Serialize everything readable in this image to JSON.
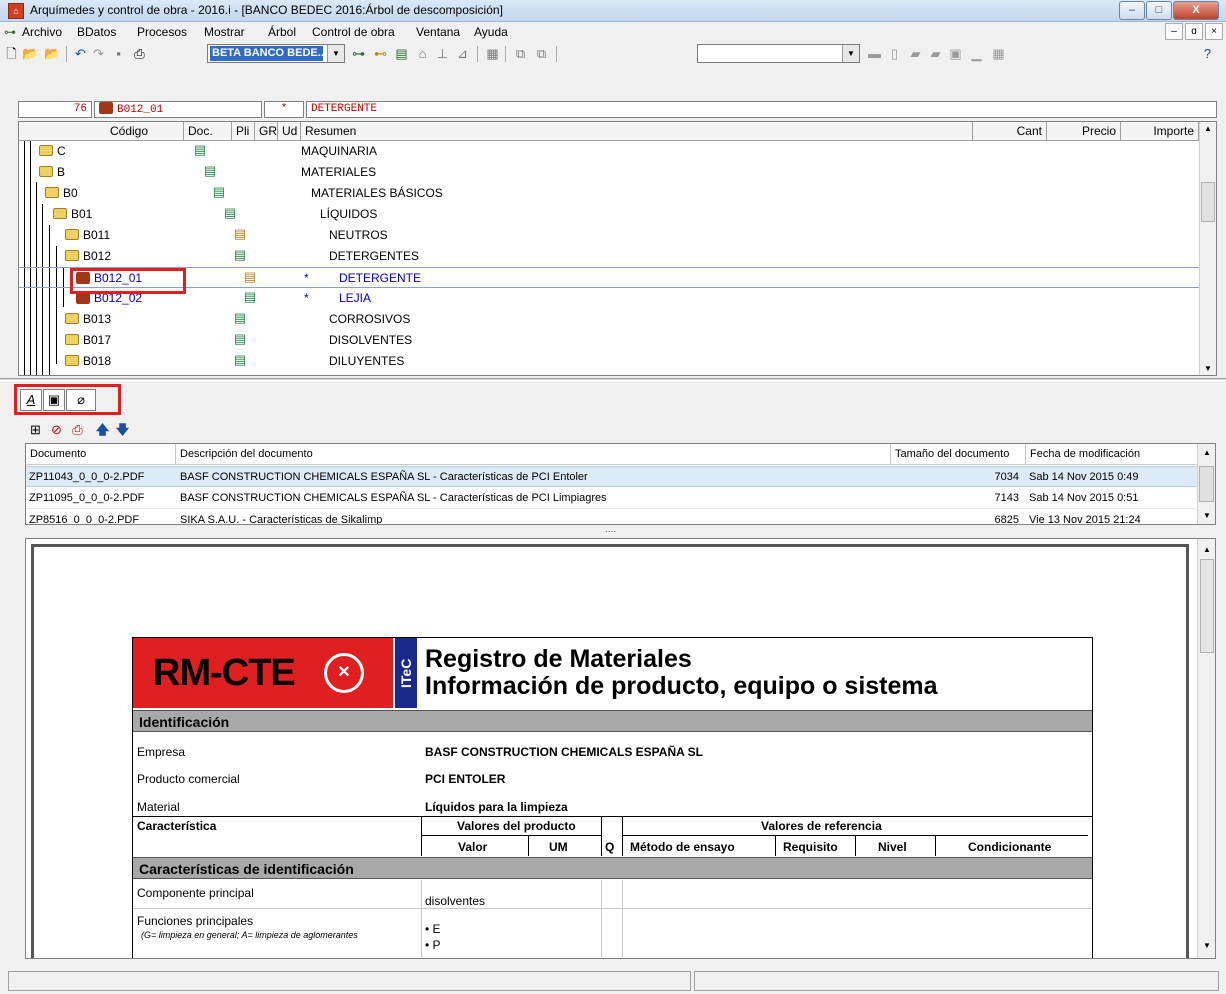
{
  "window": {
    "title": "Arquímedes y control de obra - 2016.i - [BANCO BEDEC 2016:Árbol de descomposición]",
    "min_label": "–",
    "max_label": "□",
    "close_label": "X"
  },
  "menu": {
    "items": [
      "Archivo",
      "BDatos",
      "Procesos",
      "Mostrar",
      "Árbol",
      "Control de obra",
      "Ventana",
      "Ayuda"
    ],
    "mdi_min": "–",
    "mdi_restore": "ɑ",
    "mdi_close": "×"
  },
  "toolbar": {
    "bank_combo": "BETA BANCO BEDE...",
    "search_combo": ""
  },
  "infobar": {
    "count": "76",
    "code": "B012_01",
    "star": "*",
    "summary": "DETERGENTE"
  },
  "tree": {
    "headers": {
      "codigo": "Código",
      "doc": "Doc.",
      "pli": "Pli",
      "gr": "GR",
      "ud": "Ud",
      "resumen": "Resumen",
      "cant": "Cant",
      "precio": "Precio",
      "importe": "Importe"
    },
    "rows": [
      {
        "code": "C",
        "type": "folder",
        "star": "",
        "summary": "MAQUINARIA",
        "selected": false
      },
      {
        "code": "B",
        "type": "folder",
        "star": "",
        "summary": "MATERIALES",
        "selected": false
      },
      {
        "code": "B0",
        "type": "folder",
        "star": "",
        "summary": "MATERIALES BÁSICOS",
        "selected": false
      },
      {
        "code": "B01",
        "type": "folder",
        "star": "",
        "summary": "LÍQUIDOS",
        "selected": false
      },
      {
        "code": "B011",
        "type": "folder",
        "star": "",
        "summary": "NEUTROS",
        "selected": false
      },
      {
        "code": "B012",
        "type": "folder",
        "star": "",
        "summary": "DETERGENTES",
        "selected": false
      },
      {
        "code": "B012_01",
        "type": "material",
        "star": "*",
        "summary": "DETERGENTE",
        "selected": true
      },
      {
        "code": "B012_02",
        "type": "material",
        "star": "*",
        "summary": "LEJIA",
        "selected": false
      },
      {
        "code": "B013",
        "type": "folder",
        "star": "",
        "summary": "CORROSIVOS",
        "selected": false
      },
      {
        "code": "B017",
        "type": "folder",
        "star": "",
        "summary": "DISOLVENTES",
        "selected": false
      },
      {
        "code": "B018",
        "type": "folder",
        "star": "",
        "summary": "DILUYENTES",
        "selected": false
      }
    ]
  },
  "tabs": {
    "text": "A",
    "image": "▣",
    "attach": "⌀"
  },
  "doclist": {
    "headers": {
      "documento": "Documento",
      "descripcion": "Descripción del documento",
      "tamano": "Tamaño del documento",
      "fecha": "Fecha de modificación"
    },
    "rows": [
      {
        "file": "ZP11043_0_0_0-2.PDF",
        "desc": "BASF CONSTRUCTION CHEMICALS ESPAÑA SL - Características de PCI Entoler",
        "size": "7034",
        "date": "Sab 14 Nov 2015  0:49"
      },
      {
        "file": "ZP11095_0_0_0-2.PDF",
        "desc": "BASF CONSTRUCTION CHEMICALS ESPAÑA SL - Características de PCI Limpiagres",
        "size": "7143",
        "date": "Sab 14 Nov 2015  0:51"
      },
      {
        "file": "ZP8516_0_0_0-2.PDF",
        "desc": "SIKA S.A.U. - Características de Sikalimp",
        "size": "6825",
        "date": "Vie 13 Nov 2015  21:24"
      }
    ],
    "splitter_dots": "...."
  },
  "pdf": {
    "logo": "RM-CTE",
    "itec": "ITeC",
    "title1": "Registro de Materiales",
    "title2": "Información de producto, equipo o sistema",
    "sect_ident": "Identificación",
    "empresa_label": "Empresa",
    "empresa_value": "BASF CONSTRUCTION CHEMICALS ESPAÑA SL",
    "producto_label": "Producto comercial",
    "producto_value": "PCI ENTOLER",
    "material_label": "Material",
    "material_value": "Líquidos para la limpieza",
    "caracteristica_label": "Característica",
    "valores_producto": "Valores del producto",
    "valor": "Valor",
    "um": "UM",
    "q": "Q",
    "valores_referencia": "Valores de referencia",
    "metodo": "Método de ensayo",
    "requisito": "Requisito",
    "nivel": "Nivel",
    "condicionante": "Condicionante",
    "sect_caract": "Características de identificación",
    "componente_label": "Componente principal",
    "componente_value": "disolventes",
    "funciones_label": "Funciones principales",
    "funciones_note": "(G= limpieza en general; A= limpieza de aglomerantes",
    "funciones_v1": "• E",
    "funciones_v2": "• P"
  }
}
